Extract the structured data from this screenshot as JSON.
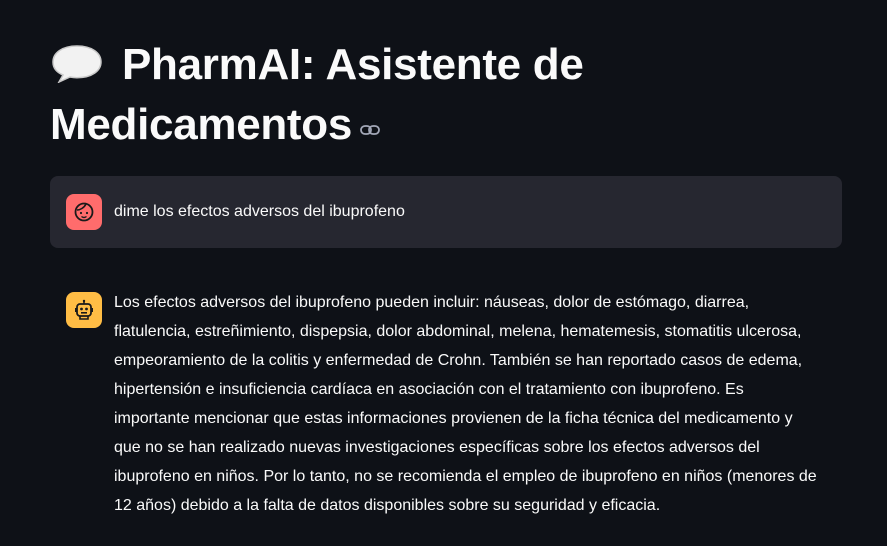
{
  "header": {
    "title_line1": "PharmAI: Asistente de",
    "title_line2": "Medicamentos",
    "emoji_icon": "speech-balloon-icon",
    "anchor_icon": "link-icon"
  },
  "messages": [
    {
      "role": "user",
      "avatar_icon": "user-face-icon",
      "avatar_color": "#ff6c6c",
      "text": "dime los efectos adversos del ibuprofeno"
    },
    {
      "role": "assistant",
      "avatar_icon": "robot-icon",
      "avatar_color": "#ffbd45",
      "text": "Los efectos adversos del ibuprofeno pueden incluir: náuseas, dolor de estómago, diarrea, flatulencia, estreñimiento, dispepsia, dolor abdominal, melena, hematemesis, stomatitis ulcerosa, empeoramiento de la colitis y enfermedad de Crohn. También se han reportado casos de edema, hipertensión e insuficiencia cardíaca en asociación con el tratamiento con ibuprofeno. Es importante mencionar que estas informaciones provienen de la ficha técnica del medicamento y que no se han realizado nuevas investigaciones específicas sobre los efectos adversos del ibuprofeno en niños. Por lo tanto, no se recomienda el empleo de ibuprofeno en niños (menores de 12 años) debido a la falta de datos disponibles sobre su seguridad y eficacia."
    }
  ],
  "colors": {
    "background": "#0e1117",
    "user_bubble": "#262730",
    "text": "#fafafa"
  }
}
